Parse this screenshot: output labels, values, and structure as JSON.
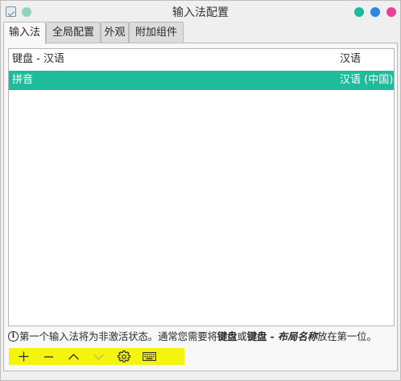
{
  "window": {
    "title": "输入法配置"
  },
  "tabs": [
    {
      "label": "输入法"
    },
    {
      "label": "全局配置"
    },
    {
      "label": "外观"
    },
    {
      "label": "附加组件"
    }
  ],
  "input_methods": [
    {
      "name": "键盘 - 汉语",
      "language": "汉语",
      "selected": false
    },
    {
      "name": "拼音",
      "language": "汉语 (中国)",
      "selected": true
    }
  ],
  "hint": {
    "part1": "第一个输入法将为非激活状态。通常您需要将",
    "bold1": "键盘",
    "part2": "或",
    "bold2": "键盘 - ",
    "italic": "布局名称",
    "part3": "放在第一位。"
  },
  "toolbar": {
    "highlight_color": "#f4f40f",
    "buttons": [
      {
        "icon": "plus-icon",
        "enabled": true
      },
      {
        "icon": "minus-icon",
        "enabled": true
      },
      {
        "icon": "chevron-up-icon",
        "enabled": true
      },
      {
        "icon": "chevron-down-icon",
        "enabled": false
      },
      {
        "icon": "gear-icon",
        "enabled": true
      },
      {
        "icon": "keyboard-icon",
        "enabled": true
      }
    ]
  },
  "colors": {
    "selection": "#1fbc9c",
    "minimize": "#1abc9c",
    "maximize": "#2e86de",
    "close": "#e84393"
  }
}
